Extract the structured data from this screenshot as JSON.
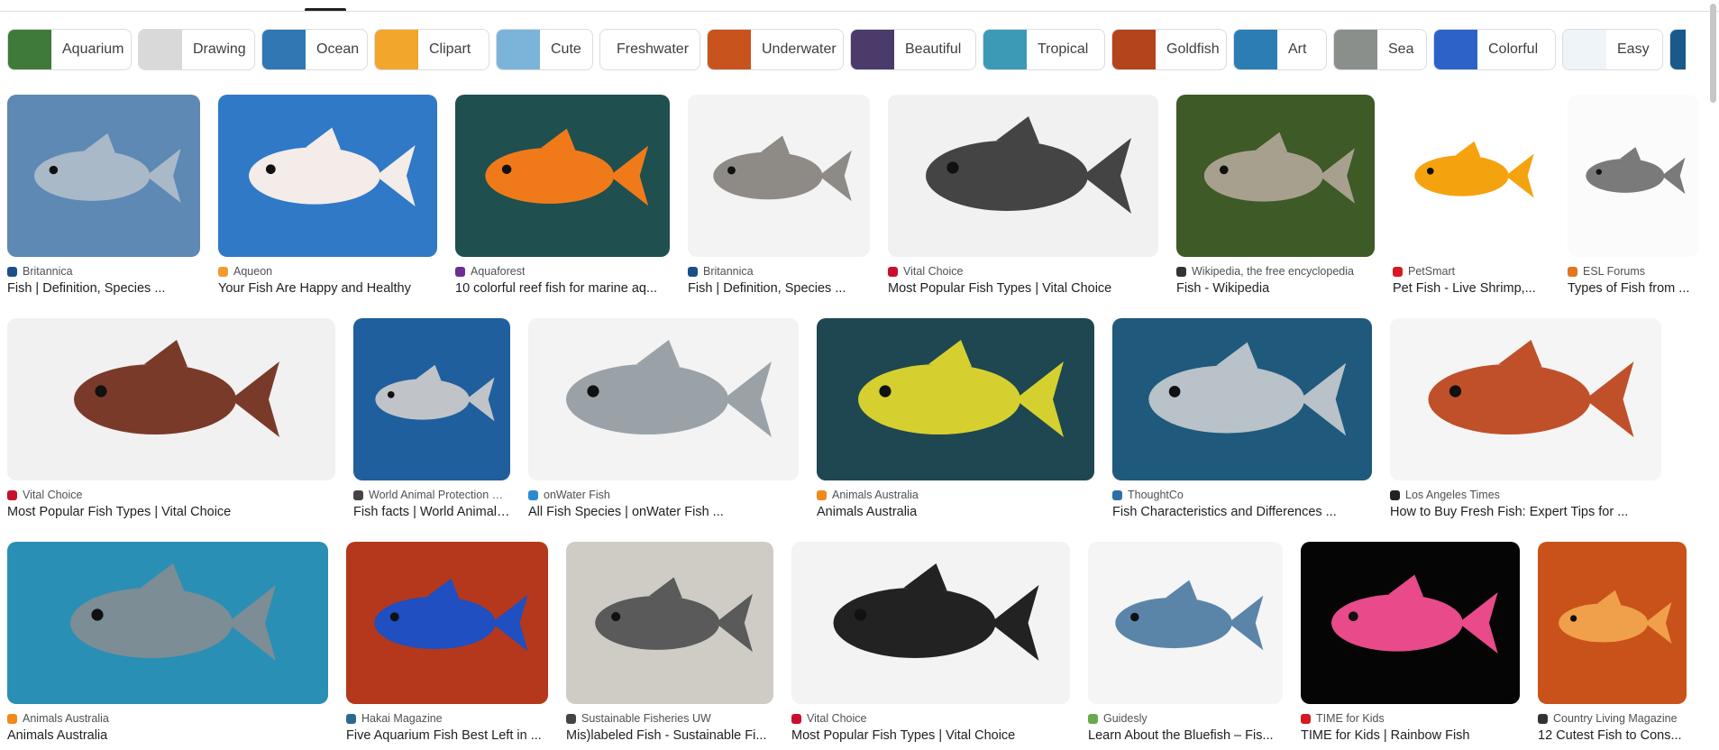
{
  "chips": [
    {
      "label": "Aquarium",
      "thumb": true,
      "color": "#3f7a3a"
    },
    {
      "label": "Drawing",
      "thumb": true,
      "color": "#d9d9d9"
    },
    {
      "label": "Ocean",
      "thumb": true,
      "color": "#2f78b4"
    },
    {
      "label": "Clipart",
      "thumb": true,
      "color": "#f2a62b"
    },
    {
      "label": "Cute",
      "thumb": true,
      "color": "#7bb4d9"
    },
    {
      "label": "Freshwater",
      "thumb": false,
      "color": ""
    },
    {
      "label": "Underwater",
      "thumb": true,
      "color": "#c9531c"
    },
    {
      "label": "Beautiful",
      "thumb": true,
      "color": "#4a3b6b"
    },
    {
      "label": "Tropical",
      "thumb": true,
      "color": "#3c9ab7"
    },
    {
      "label": "Goldfish",
      "thumb": true,
      "color": "#b3441b"
    },
    {
      "label": "Art",
      "thumb": true,
      "color": "#2d7db5"
    },
    {
      "label": "Sea",
      "thumb": true,
      "color": "#8a8f8c"
    },
    {
      "label": "Colorful",
      "thumb": true,
      "color": "#2d63c8"
    },
    {
      "label": "Easy",
      "thumb": true,
      "color": "#eef4f8"
    },
    {
      "label": "",
      "thumb": true,
      "color": "#1a5a8a"
    }
  ],
  "rows": [
    [
      {
        "source": "Britannica",
        "title": "Fish | Definition, Species ...",
        "bg": "#5d89b4",
        "fg": "#a9b9c8",
        "fav": "#1a4f8a"
      },
      {
        "source": "Aqueon",
        "title": "Your Fish Are Happy and Healthy",
        "bg": "#2f79c7",
        "fg": "#f4ece8",
        "fav": "#f39b2f"
      },
      {
        "source": "Aquaforest",
        "title": "10 colorful reef fish for marine aq...",
        "bg": "#1f4f4f",
        "fg": "#f07a1a",
        "fav": "#6b2d8f"
      },
      {
        "source": "Britannica",
        "title": "Fish | Definition, Species ...",
        "bg": "#f3f3f3",
        "fg": "#8e8a86",
        "fav": "#1a4f8a"
      },
      {
        "source": "Vital Choice",
        "title": "Most Popular Fish Types | Vital Choice",
        "bg": "#f1f1f1",
        "fg": "#444444",
        "fav": "#c8102e"
      },
      {
        "source": "Wikipedia, the free encyclopedia",
        "title": "Fish - Wikipedia",
        "bg": "#3e5a26",
        "fg": "#a8a08e",
        "fav": "#333333"
      },
      {
        "source": "PetSmart",
        "title": "Pet Fish - Live Shrimp,...",
        "bg": "#ffffff",
        "fg": "#f5a20f",
        "fav": "#d71921"
      },
      {
        "source": "ESL Forums",
        "title": "Types of Fish from ...",
        "bg": "#fbfbfb",
        "fg": "#7a7a7a",
        "fav": "#e0761e"
      }
    ],
    [
      {
        "source": "Vital Choice",
        "title": "Most Popular Fish Types | Vital Choice",
        "bg": "#f1f1f1",
        "fg": "#7a3a2a",
        "fav": "#c8102e"
      },
      {
        "source": "World Animal Protection Ca...",
        "title": "Fish facts | World Animal ...",
        "bg": "#1f5f9e",
        "fg": "#c0c4c8",
        "fav": "#444444"
      },
      {
        "source": "onWater Fish",
        "title": "All Fish Species | onWater Fish ...",
        "bg": "#f3f3f3",
        "fg": "#9aa2a8",
        "fav": "#2b8bd1"
      },
      {
        "source": "Animals Australia",
        "title": "Animals Australia",
        "bg": "#1e4752",
        "fg": "#d5d030",
        "fav": "#f08a1c"
      },
      {
        "source": "ThoughtCo",
        "title": "Fish Characteristics and Differences ...",
        "bg": "#1f5a7c",
        "fg": "#b8c2c8",
        "fav": "#2f6fa8"
      },
      {
        "source": "Los Angeles Times",
        "title": "How to Buy Fresh Fish: Expert Tips for ...",
        "bg": "#f5f5f5",
        "fg": "#c0502a",
        "fav": "#222222"
      }
    ],
    [
      {
        "source": "Animals Australia",
        "title": "Animals Australia",
        "bg": "#2a8fb5",
        "fg": "#7c8d96",
        "fav": "#f08a1c"
      },
      {
        "source": "Hakai Magazine",
        "title": "Five Aquarium Fish Best Left in ...",
        "bg": "#b5381c",
        "fg": "#1f4fc0",
        "fav": "#2b6a8f"
      },
      {
        "source": "Sustainable Fisheries UW",
        "title": "Mis)labeled Fish - Sustainable Fi...",
        "bg": "#cfccc6",
        "fg": "#5a5a5a",
        "fav": "#444444"
      },
      {
        "source": "Vital Choice",
        "title": "Most Popular Fish Types | Vital Choice",
        "bg": "#f3f3f3",
        "fg": "#222222",
        "fav": "#c8102e"
      },
      {
        "source": "Guidesly",
        "title": "Learn About the Bluefish – Fis...",
        "bg": "#f5f5f5",
        "fg": "#5b85a8",
        "fav": "#6aa84f"
      },
      {
        "source": "TIME for Kids",
        "title": "TIME for Kids | Rainbow Fish",
        "bg": "#050505",
        "fg": "#e84a8a",
        "fav": "#d71921"
      },
      {
        "source": "Country Living Magazine",
        "title": "12 Cutest Fish to Cons...",
        "bg": "#c9521a",
        "fg": "#f0a04a",
        "fav": "#333333"
      }
    ]
  ]
}
